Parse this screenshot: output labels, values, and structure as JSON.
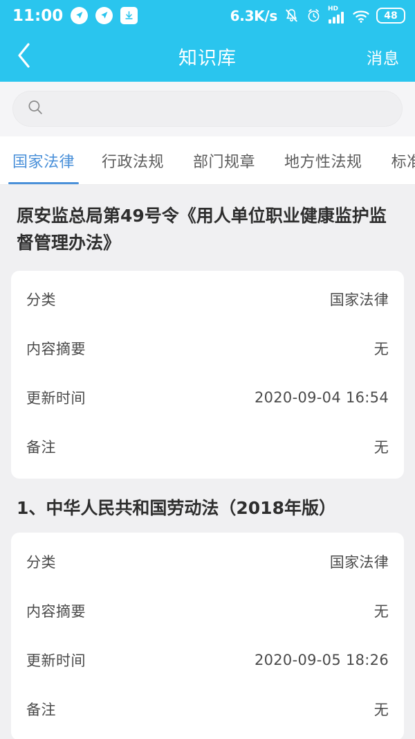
{
  "status_bar": {
    "time": "11:00",
    "network_speed": "6.3K/s",
    "battery_level": "48",
    "hd_label": "HD",
    "icons": [
      "navigation-icon",
      "navigation-icon",
      "download-icon",
      "mute-bell-icon",
      "alarm-clock-icon",
      "signal-bars-icon",
      "wifi-icon",
      "battery-icon"
    ]
  },
  "header": {
    "back_icon": "chevron-left-icon",
    "title": "知识库",
    "action_label": "消息"
  },
  "search": {
    "icon": "search-icon",
    "value": "",
    "placeholder": ""
  },
  "tabs": [
    {
      "label": "国家法律",
      "active": true
    },
    {
      "label": "行政法规",
      "active": false
    },
    {
      "label": "部门规章",
      "active": false
    },
    {
      "label": "地方性法规",
      "active": false
    },
    {
      "label": "标准",
      "active": false
    }
  ],
  "entries": [
    {
      "title": "原安监总局第49号令《用人单位职业健康监护监督管理办法》",
      "rows": [
        {
          "label": "分类",
          "value": "国家法律"
        },
        {
          "label": "内容摘要",
          "value": "无"
        },
        {
          "label": "更新时间",
          "value": "2020-09-04 16:54"
        },
        {
          "label": "备注",
          "value": "无"
        }
      ]
    },
    {
      "title": "1、中华人民共和国劳动法（2018年版）",
      "rows": [
        {
          "label": "分类",
          "value": "国家法律"
        },
        {
          "label": "内容摘要",
          "value": "无"
        },
        {
          "label": "更新时间",
          "value": "2020-09-05 18:26"
        },
        {
          "label": "备注",
          "value": "无"
        }
      ]
    }
  ],
  "colors": {
    "accent": "#2ac5ee",
    "tab_active": "#4a90d9",
    "page_background": "#f0f0f2",
    "card_background": "#ffffff"
  }
}
